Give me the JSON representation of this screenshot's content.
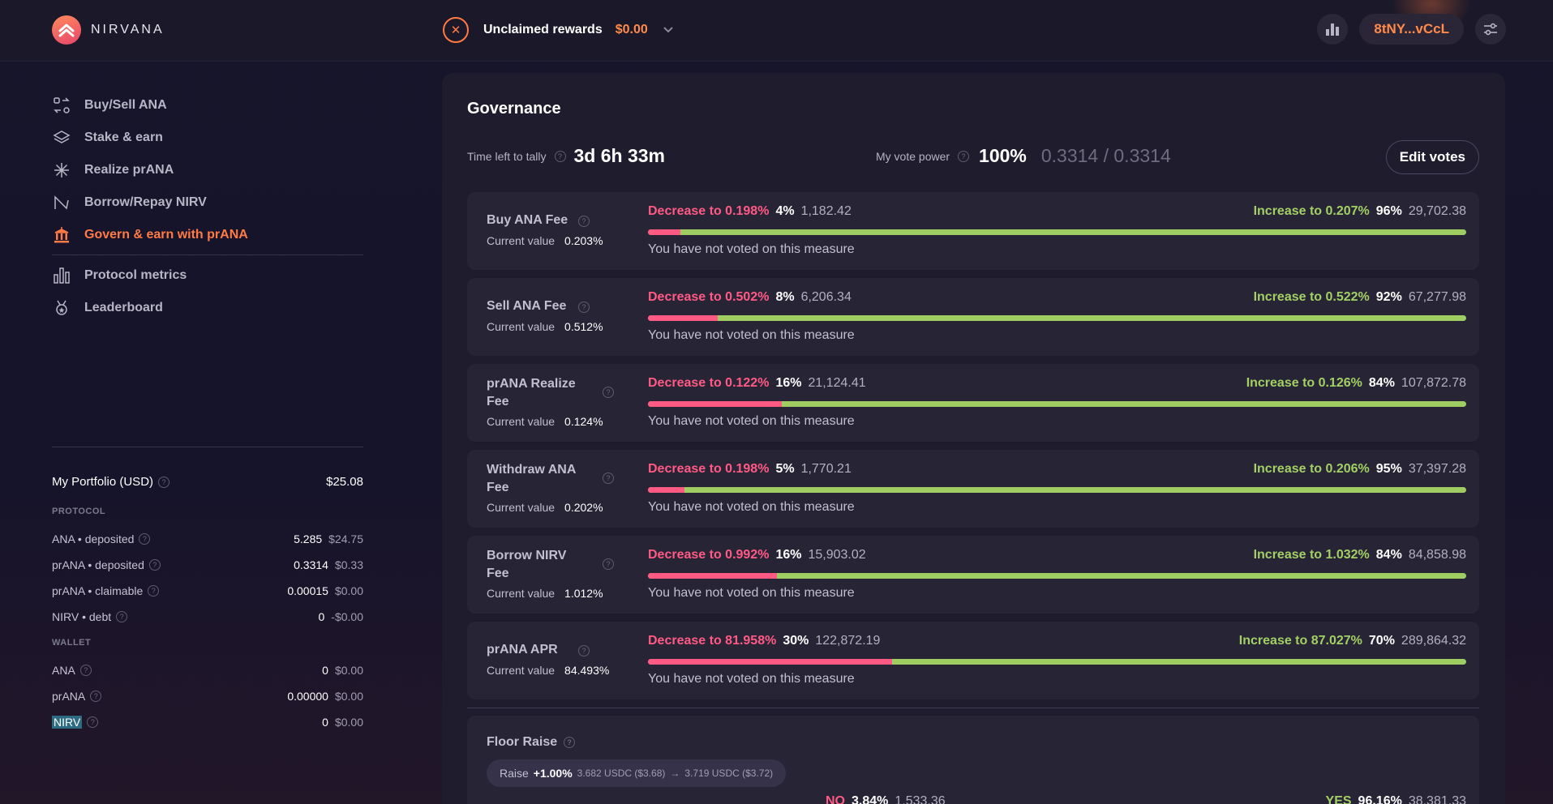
{
  "header": {
    "brand": "NIRVANA",
    "rewards_label": "Unclaimed rewards",
    "rewards_value": "$0.00",
    "wallet_address": "8tNY...vCcL"
  },
  "sidebar": {
    "items": [
      {
        "label": "Buy/Sell ANA",
        "icon": "swap-icon"
      },
      {
        "label": "Stake & earn",
        "icon": "layers-icon"
      },
      {
        "label": "Realize prANA",
        "icon": "sparkle-icon"
      },
      {
        "label": "Borrow/Repay NIRV",
        "icon": "borrow-icon"
      },
      {
        "label": "Govern & earn with prANA",
        "icon": "bank-icon",
        "active": true
      },
      {
        "label": "Protocol metrics",
        "icon": "bar-chart-icon"
      },
      {
        "label": "Leaderboard",
        "icon": "medal-icon"
      }
    ]
  },
  "portfolio": {
    "title": "My Portfolio (USD)",
    "total": "$25.08",
    "protocol_label": "PROTOCOL",
    "protocol": [
      {
        "label": "ANA • deposited",
        "amount": "5.285",
        "usd": "$24.75"
      },
      {
        "label": "prANA • deposited",
        "amount": "0.3314",
        "usd": "$0.33"
      },
      {
        "label": "prANA • claimable",
        "amount": "0.00015",
        "usd": "$0.00"
      },
      {
        "label": "NIRV • debt",
        "amount": "0",
        "usd": "-$0.00"
      }
    ],
    "wallet_label": "WALLET",
    "wallet": [
      {
        "label": "ANA",
        "amount": "0",
        "usd": "$0.00"
      },
      {
        "label": "prANA",
        "amount": "0.00000",
        "usd": "$0.00"
      },
      {
        "label": "NIRV",
        "amount": "0",
        "usd": "$0.00"
      }
    ]
  },
  "governance": {
    "title": "Governance",
    "tally_label": "Time left to tally",
    "tally_value": "3d 6h 33m",
    "vote_power_label": "My vote power",
    "vote_power_pct": "100%",
    "vote_power_ratio": "0.3314 / 0.3314",
    "edit_votes": "Edit votes",
    "current_value_label": "Current value",
    "measures": [
      {
        "name": "Buy ANA Fee",
        "current": "0.203%",
        "dec_label": "Decrease to 0.198%",
        "dec_pct": "4%",
        "dec_votes": "1,182.42",
        "inc_label": "Increase to 0.207%",
        "inc_pct": "96%",
        "inc_votes": "29,702.38",
        "dec_share": 0.04,
        "status": "You have not voted on this measure"
      },
      {
        "name": "Sell ANA Fee",
        "current": "0.512%",
        "dec_label": "Decrease to 0.502%",
        "dec_pct": "8%",
        "dec_votes": "6,206.34",
        "inc_label": "Increase to 0.522%",
        "inc_pct": "92%",
        "inc_votes": "67,277.98",
        "dec_share": 0.085,
        "status": "You have not voted on this measure"
      },
      {
        "name": "prANA Realize Fee",
        "current": "0.124%",
        "dec_label": "Decrease to 0.122%",
        "dec_pct": "16%",
        "dec_votes": "21,124.41",
        "inc_label": "Increase to 0.126%",
        "inc_pct": "84%",
        "inc_votes": "107,872.78",
        "dec_share": 0.164,
        "status": "You have not voted on this measure"
      },
      {
        "name": "Withdraw ANA Fee",
        "current": "0.202%",
        "dec_label": "Decrease to 0.198%",
        "dec_pct": "5%",
        "dec_votes": "1,770.21",
        "inc_label": "Increase to 0.206%",
        "inc_pct": "95%",
        "inc_votes": "37,397.28",
        "dec_share": 0.045,
        "status": "You have not voted on this measure"
      },
      {
        "name": "Borrow NIRV Fee",
        "current": "1.012%",
        "dec_label": "Decrease to 0.992%",
        "dec_pct": "16%",
        "dec_votes": "15,903.02",
        "inc_label": "Increase to 1.032%",
        "inc_pct": "84%",
        "inc_votes": "84,858.98",
        "dec_share": 0.158,
        "status": "You have not voted on this measure"
      },
      {
        "name": "prANA APR",
        "current": "84.493%",
        "dec_label": "Decrease to 81.958%",
        "dec_pct": "30%",
        "dec_votes": "122,872.19",
        "inc_label": "Increase to 87.027%",
        "inc_pct": "70%",
        "inc_votes": "289,864.32",
        "dec_share": 0.298,
        "status": "You have not voted on this measure"
      }
    ],
    "floor": {
      "title": "Floor Raise",
      "raise_label": "Raise",
      "raise_value": "+1.00%",
      "from": "3.682 USDC ($3.68)",
      "arrow": "→",
      "to": "3.719 USDC ($3.72)",
      "no_label": "NO",
      "no_pct": "3.84%",
      "no_votes": "1,533.36",
      "yes_label": "YES",
      "yes_pct": "96.16%",
      "yes_votes": "38,381.33"
    }
  },
  "colors": {
    "accent": "#ff7a45",
    "decrease": "#ff5a84",
    "increase": "#a3d064"
  }
}
